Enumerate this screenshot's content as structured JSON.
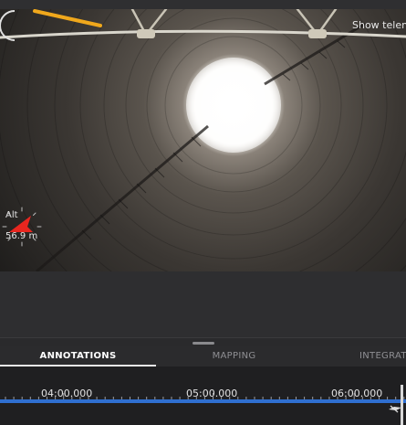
{
  "video": {
    "show_telemetry_label": "Show telem",
    "altitude": {
      "label": "Alt",
      "value": "56.9 m"
    }
  },
  "tabs": [
    {
      "label": "ANNOTATIONS",
      "active": true
    },
    {
      "label": "MAPPING",
      "active": false
    },
    {
      "label": "INTEGRATIO",
      "active": false
    }
  ],
  "timeline": {
    "labels": [
      "04:00.000",
      "05:00.000",
      "06:00.000"
    ]
  },
  "colors": {
    "accent_blue": "#2f6fd0",
    "heading_arrow": "#e8261f",
    "payload_orange": "#f0a81c"
  },
  "icons": [
    "compass-icon",
    "heading-arrow-icon",
    "drone-icon"
  ]
}
